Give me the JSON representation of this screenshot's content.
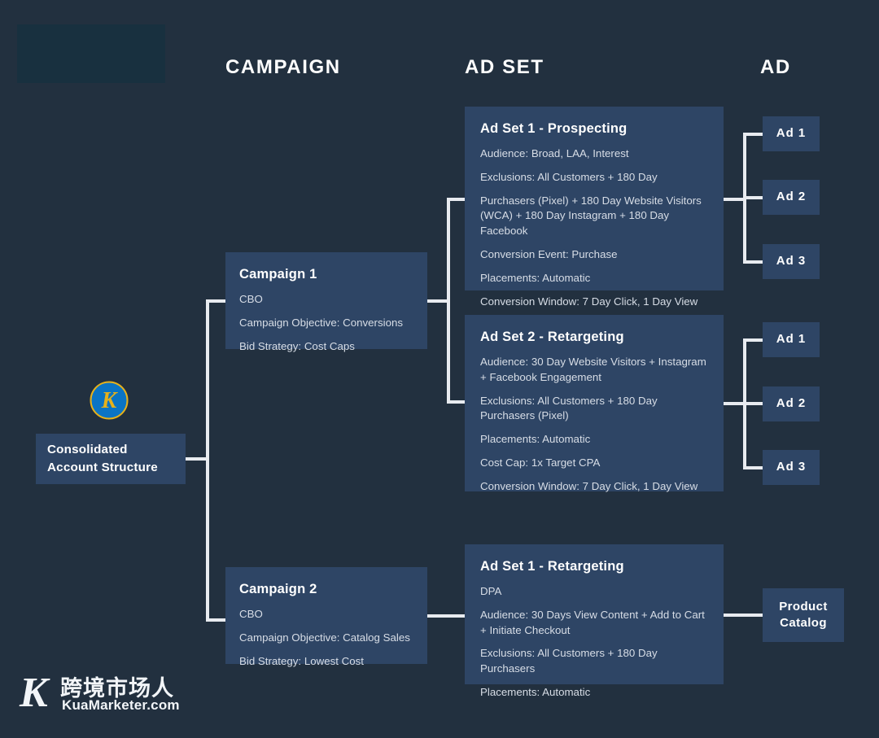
{
  "headers": {
    "campaign": "CAMPAIGN",
    "ad_set": "AD SET",
    "ad": "AD"
  },
  "root": {
    "line1": "Consolidated",
    "line2": "Account Structure",
    "logo_letter": "K"
  },
  "campaigns": [
    {
      "title": "Campaign 1",
      "lines": [
        "CBO",
        "Campaign Objective: Conversions",
        "Bid Strategy: Cost Caps"
      ]
    },
    {
      "title": "Campaign 2",
      "lines": [
        "CBO",
        "Campaign Objective: Catalog Sales",
        "Bid Strategy: Lowest Cost"
      ]
    }
  ],
  "ad_sets": [
    {
      "title": "Ad Set 1 - Prospecting",
      "lines": [
        "Audience: Broad, LAA, Interest",
        "Exclusions: All Customers + 180 Day",
        "Purchasers (Pixel) + 180 Day Website Visitors (WCA) + 180 Day Instagram + 180 Day Facebook",
        "Conversion Event: Purchase",
        "Placements: Automatic",
        "Conversion Window: 7 Day Click, 1 Day View"
      ]
    },
    {
      "title": "Ad Set 2 - Retargeting",
      "lines": [
        "Audience: 30 Day Website Visitors + Instagram + Facebook Engagement",
        "Exclusions: All Customers + 180 Day Purchasers (Pixel)",
        "Placements: Automatic",
        "Cost Cap: 1x Target CPA",
        "Conversion Window: 7 Day Click, 1 Day View"
      ]
    },
    {
      "title": "Ad Set 1 - Retargeting",
      "lines": [
        "DPA",
        "Audience: 30 Days View Content + Add to Cart + Initiate Checkout",
        "Exclusions: All Customers + 180 Day Purchasers",
        "Placements: Automatic"
      ]
    }
  ],
  "ads": {
    "set1": [
      "Ad 1",
      "Ad 2",
      "Ad 3"
    ],
    "set2": [
      "Ad 1",
      "Ad 2",
      "Ad 3"
    ],
    "catalog_line1": "Product",
    "catalog_line2": "Catalog"
  },
  "watermark": {
    "mark": "K",
    "chinese": "跨境市场人",
    "url": "KuaMarketer.com"
  },
  "colors": {
    "background": "#22303f",
    "card": "#2e4565",
    "panel": "#18303f",
    "connector": "#e8ebf0",
    "title_text": "#ffffff",
    "body_text": "#d7dde6",
    "logo_circle": "#0b74c4",
    "logo_gold": "#e7b11a"
  }
}
